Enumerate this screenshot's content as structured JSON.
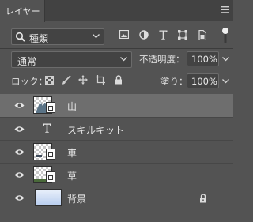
{
  "panel": {
    "tab_label": "レイヤー",
    "menu_icon": "panel-menu-icon"
  },
  "filter": {
    "kind_label": "種類",
    "icons": [
      "pixel-layer-filter-icon",
      "adjustment-layer-filter-icon",
      "type-layer-filter-icon",
      "shape-layer-filter-icon",
      "smart-object-filter-icon"
    ]
  },
  "blend": {
    "mode": "通常",
    "opacity_label": "不透明度：",
    "opacity_value": "100%"
  },
  "lock": {
    "label": "ロック：",
    "fill_label": "塗り：",
    "fill_value": "100%"
  },
  "layers": [
    {
      "name": "山",
      "type": "smart-object",
      "selected": true
    },
    {
      "name": "スキルキット",
      "type": "text",
      "selected": false
    },
    {
      "name": "車",
      "type": "smart-object",
      "selected": false
    },
    {
      "name": "草",
      "type": "smart-object",
      "selected": false
    },
    {
      "name": "背景",
      "type": "background",
      "locked": true,
      "selected": false
    }
  ],
  "colors": {
    "panel_bg": "#535353",
    "selected_row": "#6e6e6e",
    "tab_bar": "#424242"
  }
}
